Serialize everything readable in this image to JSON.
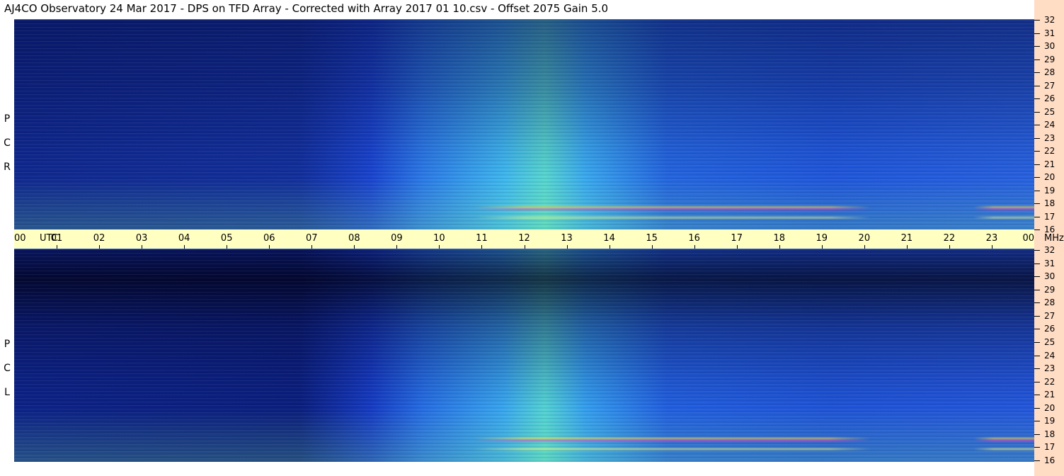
{
  "header": {
    "title": "AJ4CO Observatory  24 Mar 2017  -  DPS on TFD Array  -  Corrected with Array 2017 01 10.csv  -  Offset 2075  Gain 5.0"
  },
  "panels": {
    "top": {
      "polarization_letters": [
        "R",
        "C",
        "P"
      ]
    },
    "bottom": {
      "polarization_letters": [
        "L",
        "C",
        "P"
      ]
    }
  },
  "time_axis": {
    "start_label": "00",
    "utc_label": "UTC",
    "hour_labels": [
      "01",
      "02",
      "03",
      "04",
      "05",
      "06",
      "07",
      "08",
      "09",
      "10",
      "11",
      "12",
      "13",
      "14",
      "15",
      "16",
      "17",
      "18",
      "19",
      "20",
      "21",
      "22",
      "23"
    ],
    "end_label": "00",
    "unit_label": "MHz"
  },
  "freq_axis": {
    "labels": [
      "32",
      "31",
      "30",
      "29",
      "28",
      "27",
      "26",
      "25",
      "24",
      "23",
      "22",
      "21",
      "20",
      "19",
      "18",
      "17",
      "16"
    ]
  },
  "colors": {
    "deep": "#0a1a6e",
    "base": "#1a45d8",
    "mid": "#2f8ff0",
    "cyan": "#3fd0f0",
    "green": "#8ff080",
    "axis_time_bg": "#ffffc2",
    "axis_freq_bg": "#ffdcc4"
  }
}
